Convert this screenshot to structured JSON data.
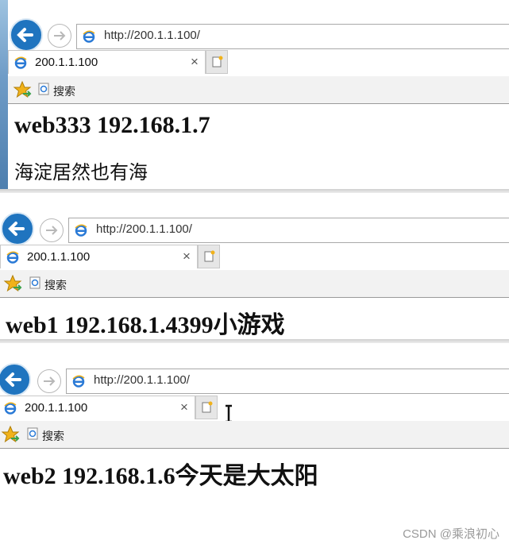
{
  "windows": [
    {
      "url": "http://200.1.1.100/",
      "tab_title": "200.1.1.100",
      "tab_close": "×",
      "favorites_label": "搜索",
      "heading": "web333 192.168.1.7",
      "paragraph": "海淀居然也有海"
    },
    {
      "url": "http://200.1.1.100/",
      "tab_title": "200.1.1.100",
      "tab_close": "×",
      "favorites_label": "搜索",
      "heading": "web1 192.168.1.4399小游戏"
    },
    {
      "url": "http://200.1.1.100/",
      "tab_title": "200.1.1.100",
      "tab_close": "×",
      "favorites_label": "搜索",
      "heading": "web2 192.168.1.6今天是大太阳"
    }
  ],
  "watermark": "CSDN @乘浪初心",
  "colors": {
    "back_button": "#1f74bf",
    "ie_icon": "#2a7ad6",
    "star": "#f1b21a"
  },
  "icons": [
    "back-arrow-icon",
    "forward-arrow-icon",
    "ie-logo-icon",
    "close-icon",
    "new-tab-icon",
    "favorites-star-icon",
    "text-cursor-icon"
  ]
}
